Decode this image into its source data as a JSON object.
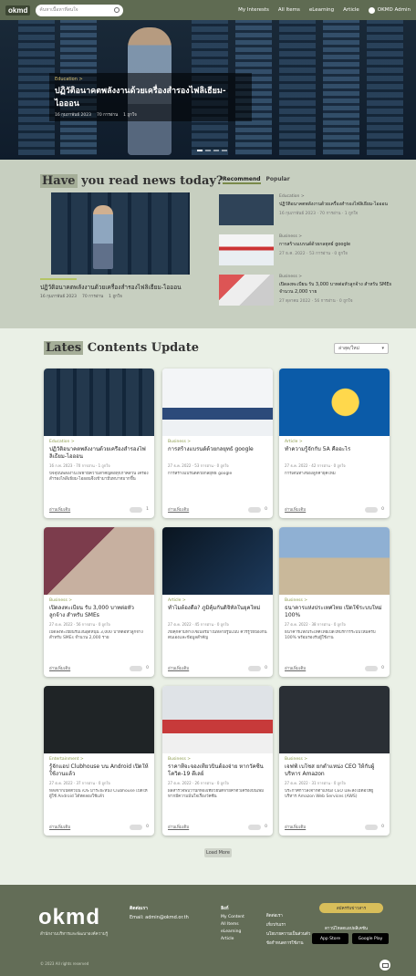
{
  "nav": {
    "logo": "okmd",
    "search_placeholder": "ค้นหาเนื้อหาที่สนใจ",
    "links": [
      "My Interests",
      "All Items",
      "eLearning",
      "Article"
    ],
    "user": "OKMD Admin"
  },
  "hero": {
    "category": "Education >",
    "title": "ปฏิวัติอนาคตพลังงานด้วยเครื่องสำรองไฟลิเธียม-ไอออน",
    "date": "16 กุมภาพันธ์ 2023",
    "views": "70 การอ่าน",
    "likes": "1 ถูกใจ"
  },
  "read": {
    "title_hl": "Have",
    "title_rest": "you read news today?",
    "tab_active": "Recommend",
    "tab_idle": "Popular",
    "feature": {
      "title": "ปฏิวัติอนาคตพลังงานด้วยเครื่องสำรองไฟลิเธียม-ไอออน",
      "date": "16 กุมภาพันธ์ 2023",
      "views": "70 การอ่าน",
      "likes": "1 ถูกใจ"
    },
    "side": [
      {
        "cat": "Education >",
        "title": "ปฏิวัติอนาคตพลังงานด้วยเครื่องสำรองไฟลิเธียม-ไอออน",
        "meta": "16 กุมภาพันธ์ 2023 · 70 การอ่าน · 1 ถูกใจ"
      },
      {
        "cat": "Business >",
        "title": "การสร้างแบรนด์ด้วยกลยุทธ์ google",
        "meta": "27 ธ.ค. 2022 · 53 การอ่าน · 0 ถูกใจ"
      },
      {
        "cat": "Business >",
        "title": "เปิดลงทะเบียน รับ 3,000 บาทต่อหัวลูกจ้าง สำหรับ SMEs จำนวน 2,000 ราย",
        "meta": "27 ตุลาคม 2022 · 56 การอ่าน · 0 ถูกใจ"
      }
    ]
  },
  "latest": {
    "title_hl": "Lates",
    "title_rest": "Contents Update",
    "sort_label": "ล่าสุด/ใหม่",
    "cards": [
      {
        "cat": "Education >",
        "title": "ปฏิวัติอนาคตพลังงานด้วยเครื่องสำรองไฟลิเธียม-ไอออน",
        "meta": "16 ก.พ. 2023 · 70 การอ่าน · 1 ถูกใจ",
        "desc": "ปัจจุบันพลังงานไฟฟ้ามีความสำคัญต่อทุกภาคส่วน เครื่องสำรองไฟลิเธียม-ไอออนจึงเข้ามามีบทบาทมากขึ้น",
        "more": "อ่านเพิ่มเติม",
        "likes": "1"
      },
      {
        "cat": "Business >",
        "title": "การสร้างแบรนด์ด้วยกลยุทธ์ google",
        "meta": "27 ธ.ค. 2022 · 53 การอ่าน · 0 ถูกใจ",
        "desc": "การสร้างแบรนด์ด้วยกลยุทธ์ google",
        "more": "อ่านเพิ่มเติม",
        "likes": "0"
      },
      {
        "cat": "Article >",
        "title": "ทำความรู้จักกับ 5A คืออะไร",
        "meta": "27 ธ.ค. 2022 · 42 การอ่าน · 0 ถูกใจ",
        "desc": "การเดินทางของลูกค้ายุคใหม่",
        "more": "อ่านเพิ่มเติม",
        "likes": "0"
      },
      {
        "cat": "Business >",
        "title": "เปิดลงทะเบียน รับ 3,000 บาทต่อหัวลูกจ้าง สำหรับ SMEs",
        "meta": "27 ต.ค. 2022 · 56 การอ่าน · 0 ถูกใจ",
        "desc": "เปิดลงทะเบียนรับเงินอุดหนุน 3,000 บาทต่อหัวลูกจ้าง สำหรับ SMEs จำนวน 2,000 ราย",
        "more": "อ่านเพิ่มเติม",
        "likes": "0"
      },
      {
        "cat": "Article >",
        "title": "ทำไมต้องดื้อ? ภูมิคุ้มกันดิจิทัลในยุคใหม่",
        "meta": "27 ต.ค. 2022 · 45 การอ่าน · 0 ถูกใจ",
        "desc": "ภัยคุกคามทางไซเบอร์มาในหลายรูปแบบ ควรรู้วิธีป้องกันตนเองและข้อมูลสำคัญ",
        "more": "อ่านเพิ่มเติม",
        "likes": "0"
      },
      {
        "cat": "Business >",
        "title": "ธนาคารแห่งประเทศไทย เปิดใช้ระบบใหม่ 100%",
        "meta": "27 ต.ค. 2022 · 38 การอ่าน · 0 ถูกใจ",
        "desc": "ธนาคารแห่งประเทศไทยเปิดให้บริการระบบใหม่ครบ 100% พร้อมรองรับผู้ใช้งาน",
        "more": "อ่านเพิ่มเติม",
        "likes": "0"
      },
      {
        "cat": "Entertainment >",
        "title": "รู้จักแอป Clubhouse บน Android เปิดให้ใช้งานแล้ว",
        "meta": "27 ต.ค. 2022 · 37 การอ่าน · 0 ถูกใจ",
        "desc": "หลังจากเปิดตัวบน iOS มาระยะหนึ่ง Clubhouse เปิดให้ผู้ใช้ Android ได้ทดลองใช้แล้ว",
        "more": "อ่านเพิ่มเติม",
        "likes": "0"
      },
      {
        "cat": "Business >",
        "title": "ราคาที่จะจองเที่ยวบินต้องจ่าย หากวัคซีนโควิด-19 ดีเลย์",
        "meta": "27 ต.ค. 2022 · 26 การอ่าน · 0 ถูกใจ",
        "desc": "ผลสำรวจพบว่านักท่องเที่ยวยินดีจ่ายค่าตั๋วเครื่องบินเพิ่ม หากมีความมั่นใจเรื่องวัคซีน",
        "more": "อ่านเพิ่มเติม",
        "likes": "0"
      },
      {
        "cat": "Business >",
        "title": "เจฟฟ์ เบโซส ยกตำแหน่ง CEO ให้กับผู้บริหาร Amazon",
        "meta": "27 ต.ค. 2022 · 31 การอ่าน · 0 ถูกใจ",
        "desc": "ประกาศก้าวลงจากตำแหน่ง CEO และส่งไม้ต่อให้ผู้บริหาร Amazon Web Services (AWS)",
        "more": "อ่านเพิ่มเติม",
        "likes": "0"
      }
    ],
    "load_more": "Load More"
  },
  "footer": {
    "brand": "okmd",
    "brand_sub": "สำนักงานบริหารและพัฒนาองค์ความรู้",
    "contact_head": "ติดต่อเรา",
    "contact_email": "Email: admin@okmd.or.th",
    "col1_head": "ลิงก์",
    "col1": [
      "My Content",
      "All Items",
      "eLearning",
      "Article"
    ],
    "col2": [
      "ติดต่อเรา",
      "เกี่ยวกับเรา",
      "นโยบายความเป็นส่วนตัว",
      "ข้อกำหนดการใช้งาน"
    ],
    "subscribe": "สมัครรับข่าวสาร",
    "apps_label": "ดาวน์โหลดแอปพลิเคชัน",
    "app_store": "App Store",
    "play_store": "Google Play",
    "copyright": "© 2023 All rights reserved"
  }
}
